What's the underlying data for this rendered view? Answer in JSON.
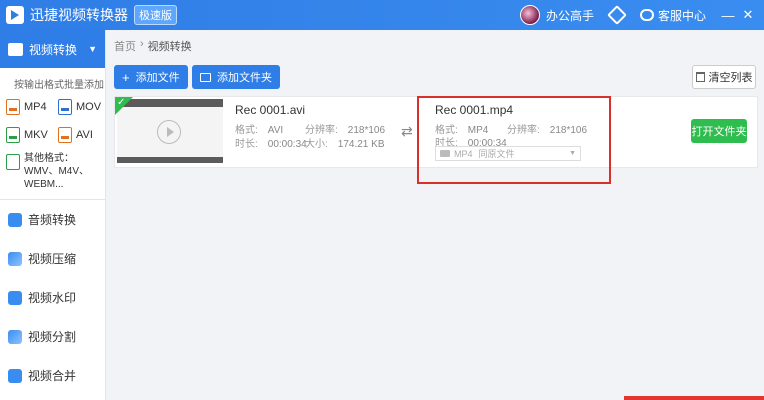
{
  "titlebar": {
    "app_name": "迅捷视频转换器",
    "edition": "极速版",
    "user_name": "办公高手",
    "service_label": "客服中心",
    "min_symbol": "—",
    "close_symbol": "✕"
  },
  "promo_text": "",
  "sidebar": {
    "active_item": "视频转换",
    "batch_hint": "按输出格式批量添加",
    "formats": [
      {
        "label": "MP4",
        "color": "orange"
      },
      {
        "label": "MOV",
        "color": "blue"
      },
      {
        "label": "MKV",
        "color": "green"
      },
      {
        "label": "AVI",
        "color": "orange"
      }
    ],
    "other_formats": "其他格式：WMV、M4V、WEBM...",
    "items": [
      {
        "label": "音频转换",
        "icon": "music-icon"
      },
      {
        "label": "视频压缩",
        "icon": "compress-icon"
      },
      {
        "label": "视频水印",
        "icon": "watermark-icon"
      },
      {
        "label": "视频分割",
        "icon": "split-icon"
      },
      {
        "label": "视频合并",
        "icon": "merge-icon"
      }
    ]
  },
  "breadcrumb": {
    "home": "首页",
    "sep": "›",
    "current": "视频转换"
  },
  "toolbar": {
    "add_file": "添加文件",
    "add_folder": "添加文件夹",
    "clear_list": "清空列表"
  },
  "file": {
    "source": {
      "name": "Rec 0001.avi",
      "format_label": "格式:",
      "format": "AVI",
      "resolution_label": "分辨率:",
      "resolution": "218*106",
      "duration_label": "时长:",
      "duration": "00:00:34",
      "size_label": "大小:",
      "size": "174.21 KB"
    },
    "target": {
      "name": "Rec 0001.mp4",
      "format_label": "格式:",
      "format": "MP4",
      "resolution_label": "分辨率:",
      "resolution": "218*106",
      "duration_label": "时长:",
      "duration": "00:00:34",
      "output_format": "MP4",
      "output_quality": "同原文件"
    },
    "open_folder": "打开文件夹"
  },
  "colors": {
    "primary": "#2f7de6",
    "success": "#2ebd4e",
    "highlight": "#d9302b"
  }
}
